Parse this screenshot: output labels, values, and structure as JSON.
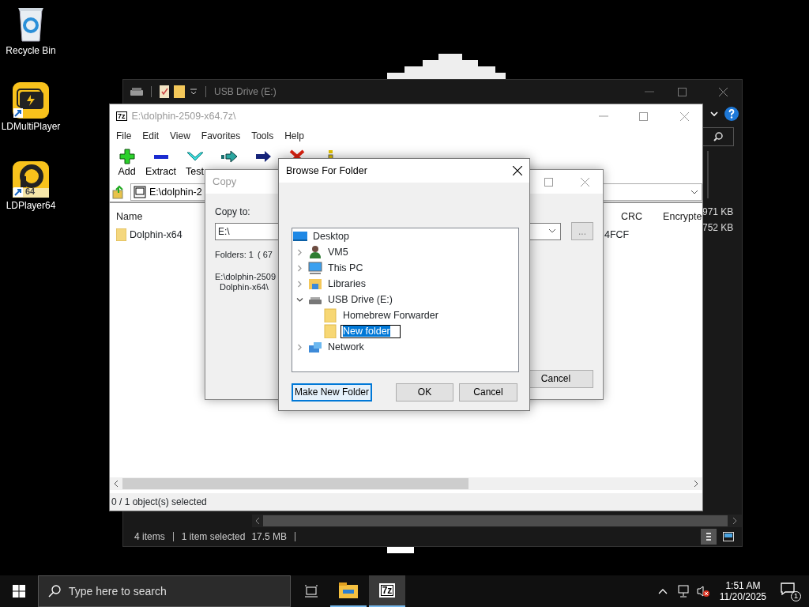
{
  "desktop_icons": [
    {
      "kind": "recycle",
      "label": "Recycle Bin"
    },
    {
      "kind": "multiplayer",
      "label": "LDMultiPlayer",
      "shortcut": true
    },
    {
      "kind": "player",
      "label": "LDPlayer64",
      "badge": "64",
      "shortcut": true
    }
  ],
  "explorer": {
    "title": "USB Drive (E:)",
    "sizes": [
      "971 KB",
      "752 KB"
    ],
    "status": [
      "4 items",
      "1 item selected",
      "17.5 MB"
    ]
  },
  "archive_window": {
    "title": "E:\\dolphin-2509-x64.7z\\",
    "app_badge": "7z",
    "menu": [
      "File",
      "Edit",
      "View",
      "Favorites",
      "Tools",
      "Help"
    ],
    "toolbar": [
      {
        "kind": "add",
        "label": "Add"
      },
      {
        "kind": "extract",
        "label": "Extract"
      },
      {
        "kind": "test",
        "label": "Test"
      },
      {
        "kind": "copy"
      },
      {
        "kind": "move"
      },
      {
        "kind": "delete"
      },
      {
        "kind": "info"
      }
    ],
    "address": "E:\\dolphin-2",
    "columns": [
      "Name",
      "CRC",
      "Encrypte"
    ],
    "rows": [
      {
        "name": "Dolphin-x64",
        "crc": "4FCF"
      }
    ],
    "status": "0 / 1 object(s) selected"
  },
  "copy_dialog": {
    "title": "Copy",
    "copy_to_label": "Copy to:",
    "path": "E:\\",
    "folders": "Folders: 1",
    "size": "( 67",
    "source": [
      "E:\\dolphin-2509",
      "Dolphin-x64\\"
    ],
    "browse_button": "...",
    "cancel": "Cancel"
  },
  "browse_dialog": {
    "title": "Browse For Folder",
    "tree": [
      {
        "kind": "desktop",
        "label": "Desktop",
        "children": [
          {
            "kind": "user",
            "label": "VM5",
            "expanded": false
          },
          {
            "kind": "pc",
            "label": "This PC",
            "expanded": false
          },
          {
            "kind": "libraries",
            "label": "Libraries",
            "expanded": false
          },
          {
            "kind": "drive",
            "label": "USB Drive (E:)",
            "expanded": true,
            "children": [
              {
                "kind": "folder",
                "label": "Homebrew Forwarder",
                "editing": false
              },
              {
                "kind": "folder",
                "label": "New folder",
                "editing": true
              }
            ]
          },
          {
            "kind": "network",
            "label": "Network",
            "expanded": false
          }
        ]
      }
    ],
    "buttons": [
      {
        "label": "Make New Folder",
        "default": true
      },
      {
        "label": "OK",
        "default": false
      },
      {
        "label": "Cancel",
        "default": false
      }
    ]
  },
  "taskbar": {
    "search_placeholder": "Type here to search",
    "apps": [
      {
        "kind": "explorer",
        "selected": false
      },
      {
        "kind": "archiver",
        "label": "7z",
        "selected": true
      }
    ],
    "time": "1:51 AM",
    "date": "11/20/2025",
    "notifications": "1"
  }
}
